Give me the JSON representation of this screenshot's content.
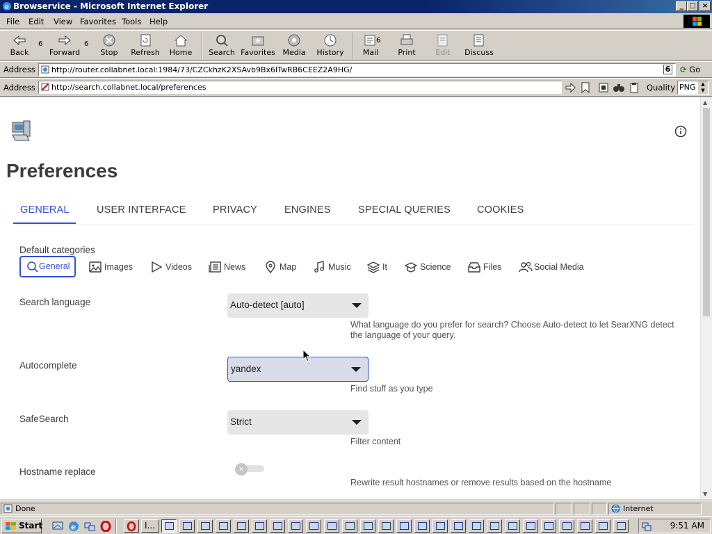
{
  "window": {
    "title": "Browservice - Microsoft Internet Explorer"
  },
  "menu": [
    "File",
    "Edit",
    "View",
    "Favorites",
    "Tools",
    "Help"
  ],
  "toolbar": {
    "back": "Back",
    "forward": "Forward",
    "stop": "Stop",
    "refresh": "Refresh",
    "home": "Home",
    "search": "Search",
    "favorites": "Favorites",
    "media": "Media",
    "history": "History",
    "mail": "Mail",
    "print": "Print",
    "edit": "Edit",
    "discuss": "Discuss",
    "back_count": "6",
    "forward_count": "6",
    "mail_count": "6"
  },
  "address1": {
    "label": "Address",
    "url": "http://router.collabnet.local:1984/73/CZCkhzK2XSAvb9Bx6lTwRB6CEEZ2A9HG/",
    "go": "Go",
    "links_badge": "6"
  },
  "address2": {
    "label": "Address",
    "url": "http://search.collabnet.local/preferences",
    "quality_label": "Quality",
    "quality_value": "PNG"
  },
  "page": {
    "title": "Preferences",
    "tabs": [
      "GENERAL",
      "USER INTERFACE",
      "PRIVACY",
      "ENGINES",
      "SPECIAL QUERIES",
      "COOKIES"
    ],
    "active_tab": "GENERAL",
    "default_categories_label": "Default categories",
    "categories": [
      "General",
      "Images",
      "Videos",
      "News",
      "Map",
      "Music",
      "It",
      "Science",
      "Files",
      "Social Media"
    ],
    "selected_category": "General",
    "search_language": {
      "label": "Search language",
      "value": "Auto-detect [auto]",
      "help": "What language do you prefer for search? Choose Auto-detect to let SearXNG detect the language of your query."
    },
    "autocomplete": {
      "label": "Autocomplete",
      "value": "yandex",
      "help": "Find stuff as you type"
    },
    "safesearch": {
      "label": "SafeSearch",
      "value": "Strict",
      "help": "Filter content"
    },
    "hostname_replace": {
      "label": "Hostname replace",
      "enabled": false,
      "help": "Rewrite result hostnames or remove results based on the hostname"
    }
  },
  "status": {
    "text": "Done",
    "zone": "Internet"
  },
  "taskbar": {
    "start": "Start",
    "time": "9:51 AM",
    "ie_label": "I..."
  },
  "colors": {
    "accent": "#3050d6",
    "title_bar": "#0a246a"
  }
}
